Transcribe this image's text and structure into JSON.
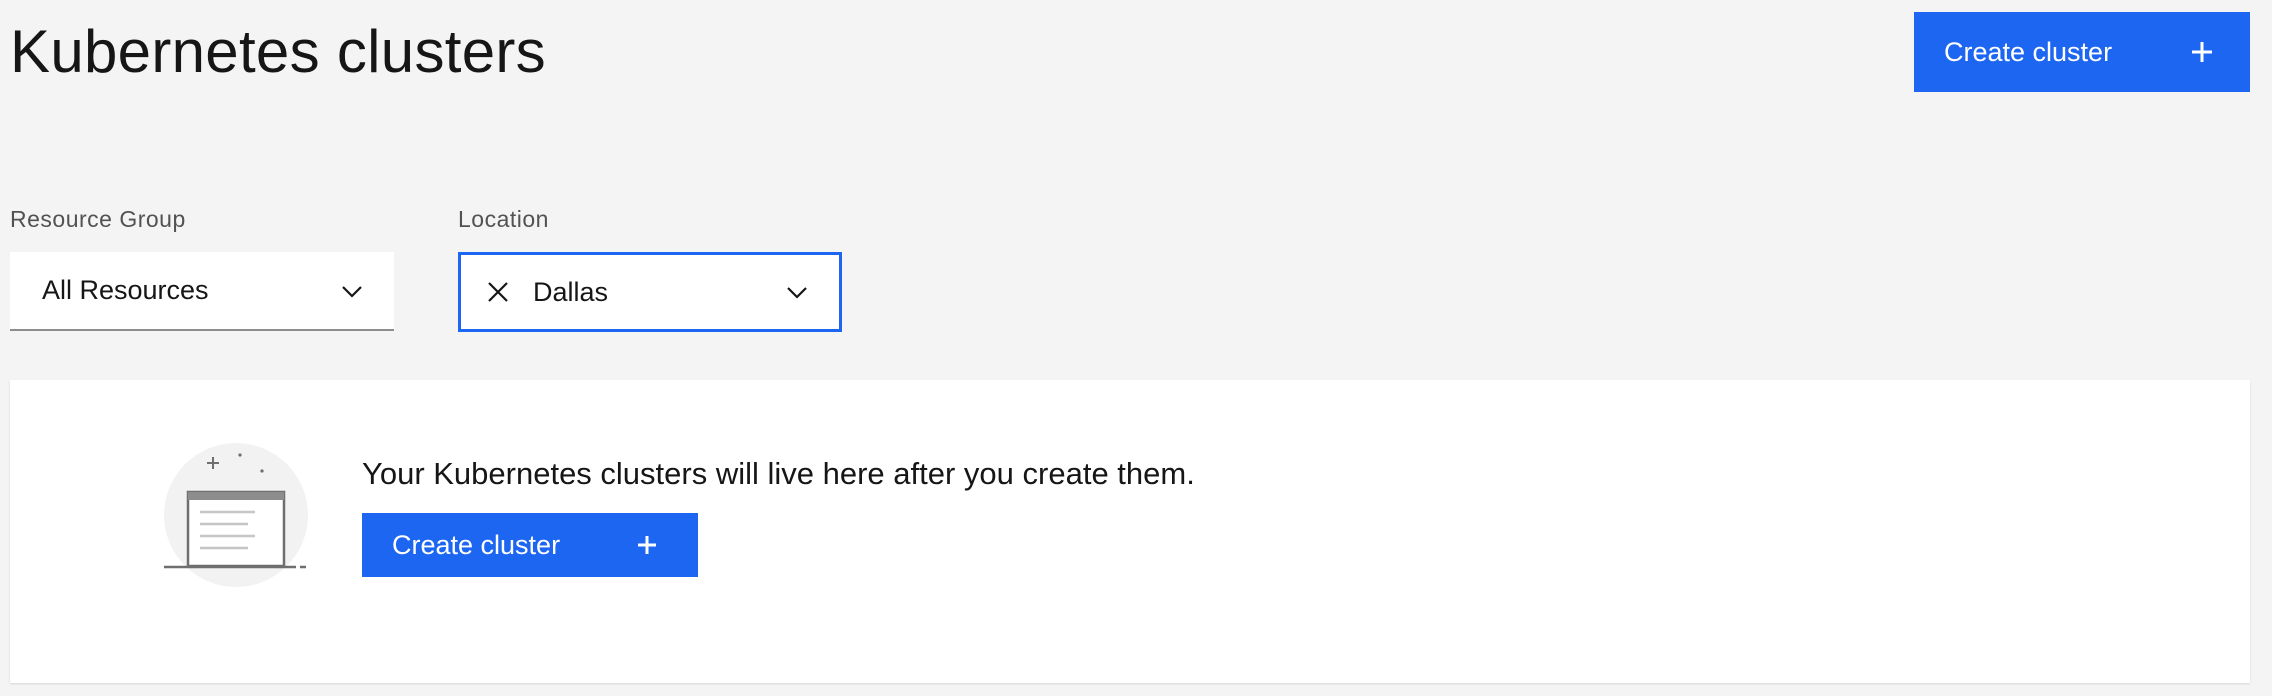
{
  "header": {
    "title": "Kubernetes clusters",
    "create_button_label": "Create cluster"
  },
  "filters": {
    "resource_group": {
      "label": "Resource Group",
      "value": "All Resources"
    },
    "location": {
      "label": "Location",
      "value": "Dallas"
    }
  },
  "empty_state": {
    "message": "Your Kubernetes clusters will live here after you create them.",
    "create_button_label": "Create cluster"
  },
  "colors": {
    "accent": "#1d66f2",
    "background": "#f4f4f4",
    "panel": "#ffffff",
    "text": "#161616"
  },
  "icons": [
    "plus-icon",
    "chevron-down-icon",
    "close-icon",
    "empty-clusters-illustration"
  ]
}
